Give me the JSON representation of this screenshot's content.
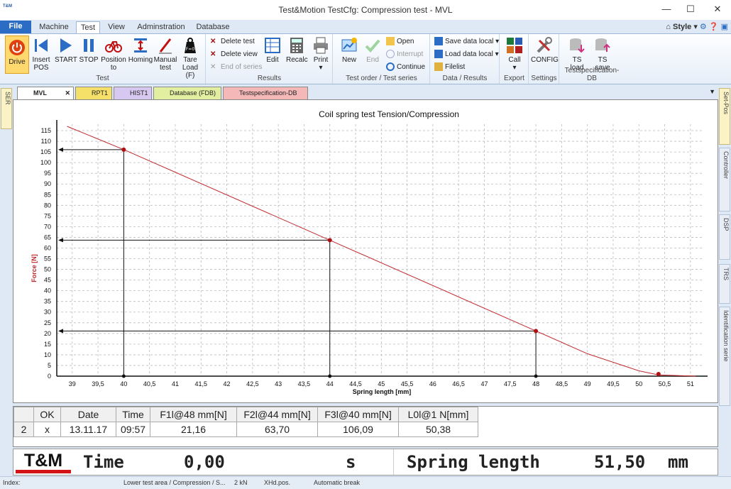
{
  "window": {
    "title": "Test&Motion  TestCfg: Compression test - MVL",
    "app_icon": "T&M",
    "minimize": "—",
    "maximize": "☐",
    "close": "✕"
  },
  "ribbon_tabs": [
    "File",
    "Machine",
    "Test",
    "View",
    "Adminstration",
    "Database"
  ],
  "style_label": "Style",
  "groups": {
    "test": {
      "label": "Test",
      "buttons": [
        "Drive",
        "Insert POS",
        "START",
        "STOP",
        "Position to",
        "Homing",
        "Manual test",
        "Tare Load (F)"
      ]
    },
    "results": {
      "label": "Results",
      "delete_test": "Delete test",
      "delete_view": "Delete view",
      "end_of_series": "End of series",
      "edit": "Edit",
      "recalc": "Recalc",
      "print": "Print"
    },
    "order": {
      "label": "Test order / Test series",
      "new": "New",
      "end": "End",
      "open": "Open",
      "interrupt": "Interrupt",
      "continue": "Continue"
    },
    "data": {
      "label": "Data / Results",
      "save": "Save data local",
      "load": "Load data local",
      "filelist": "Filelist"
    },
    "export": {
      "label": "Export",
      "call": "Call"
    },
    "settings": {
      "label": "Settings",
      "config": "CONFIG"
    },
    "tsdb": {
      "label": "Testspecification-DB",
      "load": "TS load",
      "save": "TS save"
    }
  },
  "doc_tabs": [
    "MVL",
    "RPT1",
    "HIST1",
    "Database (FDB)",
    "Testspecification-DB"
  ],
  "left_tabs": [
    "SER"
  ],
  "right_tabs": [
    "Set-Pos",
    "Controller",
    "DSP",
    "TRS",
    "Identification serie"
  ],
  "chart_data": {
    "type": "line",
    "title": "Coil spring test Tension/Compression",
    "xlabel": "Spring length [mm]",
    "ylabel": "Force [N]",
    "xlim": [
      38.7,
      51.25
    ],
    "ylim": [
      0,
      118
    ],
    "xticks": [
      "39",
      "39,5",
      "40",
      "40,5",
      "41",
      "41,5",
      "42",
      "42,5",
      "43",
      "43,5",
      "44",
      "44,5",
      "45",
      "45,5",
      "46",
      "46,5",
      "47",
      "47,5",
      "48",
      "48,5",
      "49",
      "49,5",
      "50",
      "50,5",
      "51"
    ],
    "yticks": [
      "0",
      "5",
      "10",
      "15",
      "20",
      "25",
      "30",
      "35",
      "40",
      "45",
      "50",
      "55",
      "60",
      "65",
      "70",
      "75",
      "80",
      "85",
      "90",
      "95",
      "100",
      "105",
      "110",
      "115"
    ],
    "series": [
      {
        "x": [
          38.9,
          40,
          44,
          48,
          49,
          50,
          50.38,
          51.1
        ],
        "y": [
          117,
          106.09,
          63.7,
          21.16,
          10.5,
          2.5,
          0.6,
          0
        ]
      }
    ],
    "markers": [
      {
        "x": 40,
        "y": 106.09
      },
      {
        "x": 44,
        "y": 63.7
      },
      {
        "x": 48,
        "y": 21.16
      },
      {
        "x": 50.38,
        "y": 1
      }
    ],
    "grid": true,
    "line_color": "#c0282d",
    "marker_color": "#b01010"
  },
  "results_table": {
    "headers": [
      "",
      "OK",
      "Date",
      "Time",
      "F1l@48 mm[N]",
      "F2l@44 mm[N]",
      "F3l@40 mm[N]",
      "L0l@1 N[mm]"
    ],
    "rows": [
      [
        "2",
        "x",
        "13.11.17",
        "09:57",
        "21,16",
        "63,70",
        "106,09",
        "50,38"
      ]
    ]
  },
  "display": {
    "logo": "T&M",
    "time_label": "Time",
    "time_value": "0,00",
    "time_unit": "s",
    "length_label": "Spring length",
    "length_value": "51,50",
    "length_unit": "mm"
  },
  "status": {
    "index": "Index:",
    "area": "Lower test area / Compression / S...",
    "load": "2 kN",
    "pos": "XHd.pos.",
    "break": "Automatic break"
  },
  "colors": {
    "accent": "#2b6cc4",
    "logo_red": "#d41414",
    "series": "#c0282d"
  }
}
